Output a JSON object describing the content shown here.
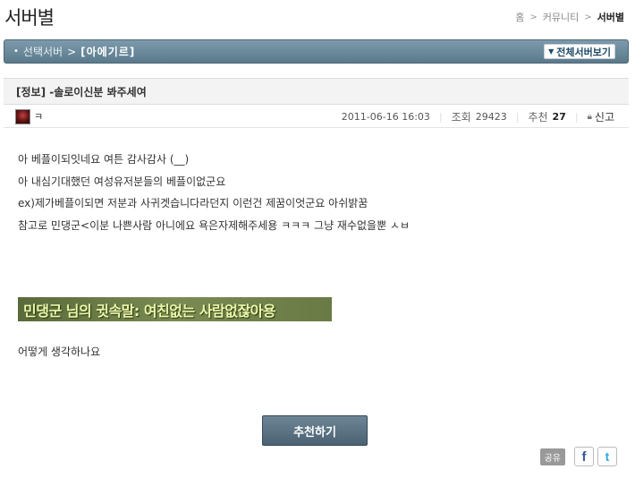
{
  "page": {
    "title": "서버별"
  },
  "breadcrumb": {
    "items": [
      "홈",
      "커뮤니티"
    ],
    "current": "서버별"
  },
  "server_bar": {
    "select_label": "선택서버",
    "server_name": "[아에기르]",
    "all_servers_label": "전체서버보기"
  },
  "post": {
    "title": "[정보] -솔로이신분 봐주세여",
    "author": "ㅋ",
    "datetime": "2011-06-16 16:03",
    "views_label": "조회",
    "views": "29423",
    "recommend_label": "추천",
    "recommend": "27",
    "report_label": "신고",
    "lines": [
      "아 베플이되잇네요 여튼 감사감사 (__)",
      "아 내심기대했던 여성유저분들의 베플이없군요",
      "ex)제가베플이되면 저분과 사귀겟습니다라던지 이런건 제꿈이엇군요 아쉬밝꿈",
      "참고로 민댕군<이분 나쁜사람 아니에요 욕은자제해주세용 ㅋㅋㅋ 그냥 재수없을뿐 ㅅㅂ"
    ],
    "highlight": "민댕군 님의 귓속말: 여친없는 사람없잖아용",
    "question": "어떻게 생각하나요"
  },
  "actions": {
    "recommend_button": "추천하기"
  },
  "share": {
    "label": "공유",
    "facebook": "f",
    "twitter": "t"
  }
}
